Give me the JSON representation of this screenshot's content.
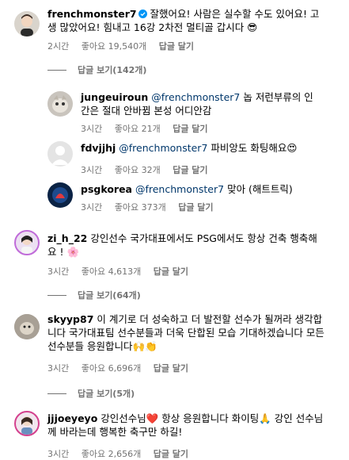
{
  "comments": [
    {
      "user": "frenchmonster7",
      "verified": true,
      "text": "잘했어요! 사람은 실수할 수도 있어요! 고생 많았어요! 힘내고 16강 2차전 멀티골 갑시다 😎",
      "time": "2시간",
      "likes": "좋아요 19,540개",
      "reply": "답글 달기",
      "view_replies": "답글 보기(142개)"
    },
    {
      "user": "jungeuiroun",
      "mention": "@frenchmonster7",
      "text": "놉 저런부류의 인간은 절대 안바뀜 본성 어디안감",
      "time": "3시간",
      "likes": "좋아요 21개",
      "reply": "답글 달기"
    },
    {
      "user": "fdvjjhj",
      "mention": "@frenchmonster7",
      "text": "파비앙도 화팅해요😍",
      "time": "3시간",
      "likes": "좋아요 32개",
      "reply": "답글 달기"
    },
    {
      "user": "psgkorea",
      "mention": "@frenchmonster7",
      "text": "맞아 (해트트릭)",
      "time": "3시간",
      "likes": "좋아요 373개",
      "reply": "답글 달기"
    },
    {
      "user": "zi_h_22",
      "text": "강인선수 국가대표에서도 PSG에서도 항상 건축 행축해요 ! 🌸",
      "time": "3시간",
      "likes": "좋아요 4,613개",
      "reply": "답글 달기",
      "view_replies": "답글 보기(64개)"
    },
    {
      "user": "skyyp87",
      "text": "이 계기로 더 성숙하고 더 발전할 선수가 될꺼라 생각합니다 국가대표팀 선수분들과 더욱 단합된 모습 기대하겠습니다 모든 선수분들 응원합니다🙌👏",
      "time": "3시간",
      "likes": "좋아요 6,696개",
      "reply": "답글 달기",
      "view_replies": "답글 보기(5개)"
    },
    {
      "user": "jjjoeyeyo",
      "text": "강인선수님❤️ 항상 응원합니다 화이팅🙏 강인 선수님께 바라는데 행복한 축구만 하길!",
      "time": "3시간",
      "likes": "좋아요 2,656개",
      "reply": "답글 달기"
    }
  ],
  "colors": {
    "mention": "#00376b",
    "meta": "#737373",
    "verified": "#0095f6"
  }
}
